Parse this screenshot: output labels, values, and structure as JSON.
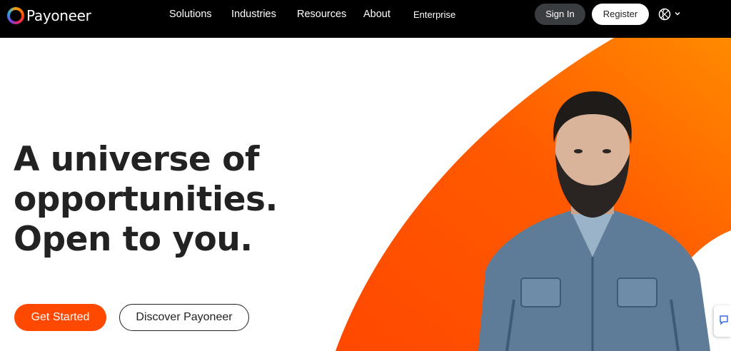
{
  "brand": {
    "name": "Payoneer",
    "accent": "#ff4800"
  },
  "nav": {
    "links": [
      "Solutions",
      "Industries",
      "Resources",
      "About",
      "Enterprise"
    ],
    "sign_in": "Sign In",
    "register": "Register",
    "language_icon": "globe-icon"
  },
  "hero": {
    "headline_lines": [
      "A universe of",
      "opportunities.",
      "Open to you."
    ],
    "cta_primary": "Get Started",
    "cta_secondary": "Discover Payoneer"
  },
  "colors": {
    "nav_bg": "#000000",
    "orange": "#ff4800",
    "orange_light": "#ff8a00",
    "text": "#222222"
  }
}
